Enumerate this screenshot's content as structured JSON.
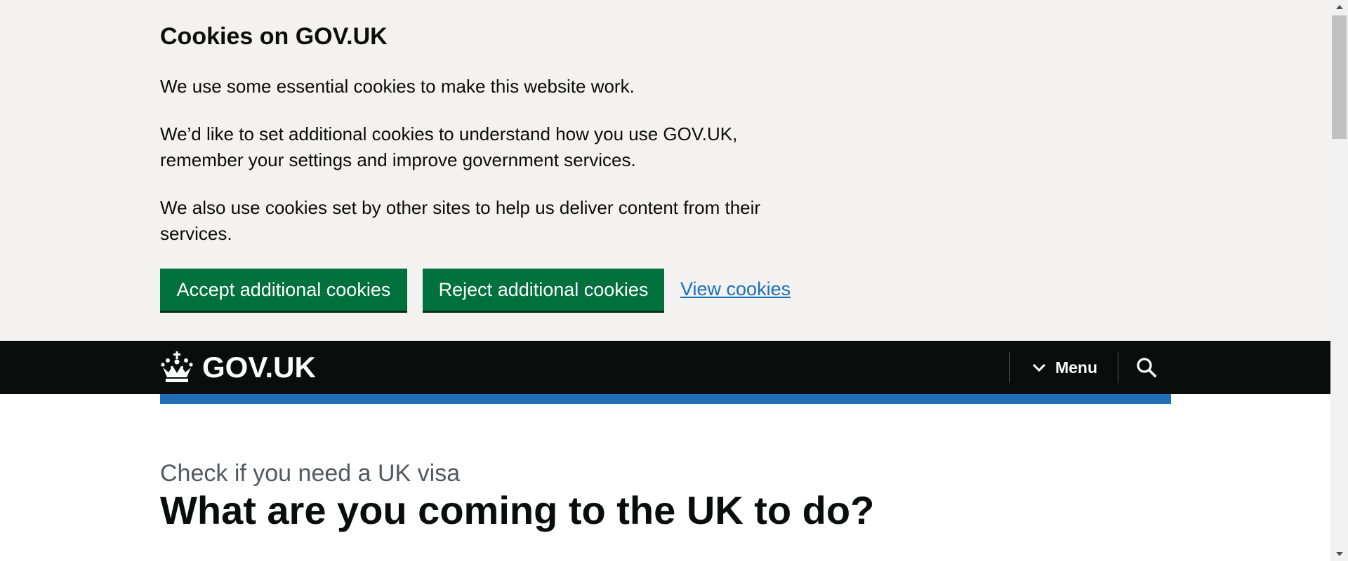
{
  "cookie_banner": {
    "title": "Cookies on GOV.UK",
    "paragraph_1": "We use some essential cookies to make this website work.",
    "paragraph_2": "We’d like to set additional cookies to understand how you use GOV.UK, remember your settings and improve government services.",
    "paragraph_3": "We also use cookies set by other sites to help us deliver content from their services.",
    "accept_label": "Accept additional cookies",
    "reject_label": "Reject additional cookies",
    "view_label": "View cookies"
  },
  "header": {
    "logo_text": "GOV.UK",
    "menu_label": "Menu",
    "search_icon": "search-icon",
    "menu_icon": "chevron-down-icon",
    "logo_icon": "crown-icon"
  },
  "main": {
    "caption": "Check if you need a UK visa",
    "heading": "What are you coming to the UK to do?"
  },
  "colors": {
    "banner_bg": "#f3f2f1",
    "header_bg": "#0b0c0c",
    "brand_blue": "#1d70b8",
    "button_green": "#00703c",
    "caption_grey": "#505a5f"
  }
}
